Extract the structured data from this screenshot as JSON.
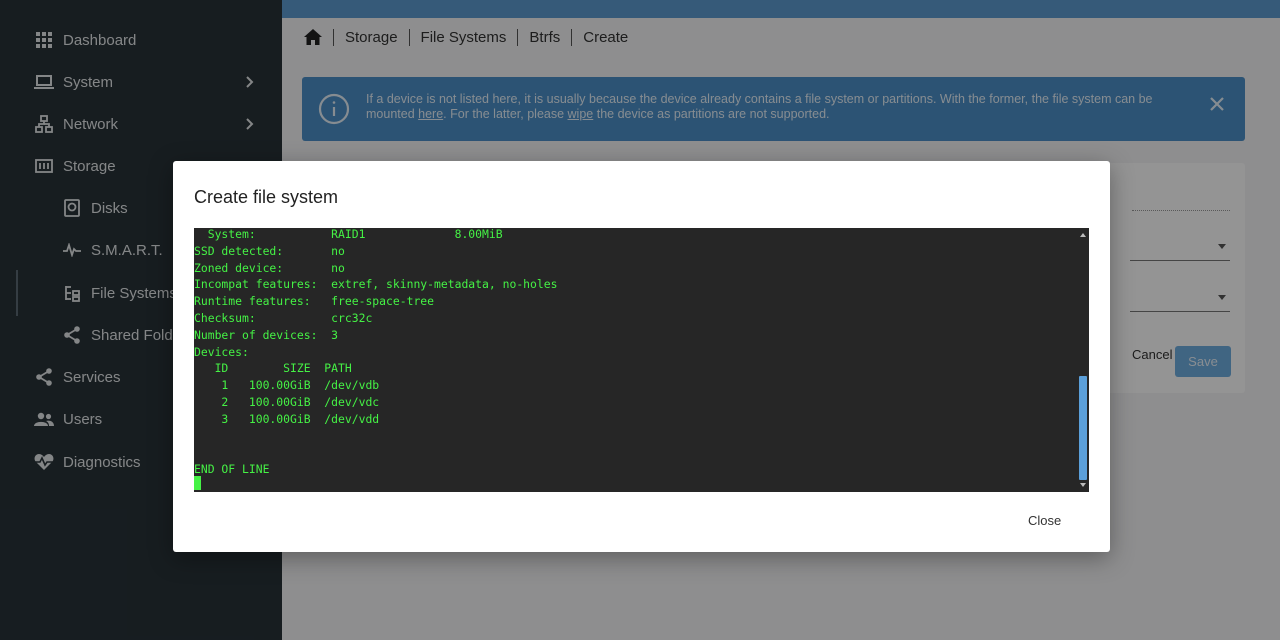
{
  "sidebar": {
    "items": [
      {
        "label": "Dashboard",
        "icon": "grid-icon"
      },
      {
        "label": "System",
        "icon": "laptop-icon"
      },
      {
        "label": "Network",
        "icon": "network-icon"
      },
      {
        "label": "Storage",
        "icon": "storage-icon"
      },
      {
        "label": "Disks",
        "icon": "disk-icon"
      },
      {
        "label": "S.M.A.R.T.",
        "icon": "pulse-icon"
      },
      {
        "label": "File Systems",
        "icon": "tree-icon"
      },
      {
        "label": "Shared Folders",
        "icon": "share-icon"
      },
      {
        "label": "Services",
        "icon": "share-icon"
      },
      {
        "label": "Users",
        "icon": "users-icon"
      },
      {
        "label": "Diagnostics",
        "icon": "heart-pulse-icon"
      }
    ]
  },
  "breadcrumb": {
    "items": [
      "Storage",
      "File Systems",
      "Btrfs",
      "Create"
    ]
  },
  "alert": {
    "text_1": "If a device is not listed here, it is usually because the device already contains a file system or partitions. With the former, the file system can be mounted ",
    "link_here": "here",
    "text_2": ". For the latter, please ",
    "link_wipe": "wipe",
    "text_3": " the device as partitions are not supported."
  },
  "form": {
    "cancel_label": "Cancel",
    "save_label": "Save"
  },
  "dialog": {
    "title": "Create file system",
    "close_label": "Close",
    "terminal_output": "  System:           RAID1             8.00MiB\nSSD detected:       no\nZoned device:       no\nIncompat features:  extref, skinny-metadata, no-holes\nRuntime features:   free-space-tree\nChecksum:           crc32c\nNumber of devices:  3\nDevices:\n   ID        SIZE  PATH\n    1   100.00GiB  /dev/vdb\n    2   100.00GiB  /dev/vdc\n    3   100.00GiB  /dev/vdd\n\n\nEND OF LINE"
  },
  "colors": {
    "sidebar_bg": "#283238",
    "accent": "#5d9cd0",
    "terminal_bg": "#262626",
    "terminal_fg": "#45f245"
  }
}
